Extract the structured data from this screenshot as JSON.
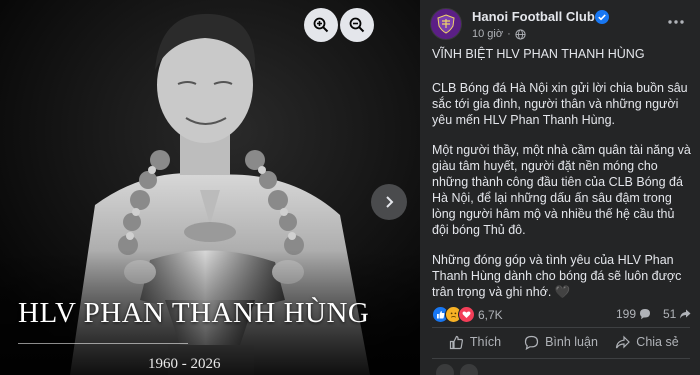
{
  "viewer": {
    "overlay_name": "HLV PHAN THANH HÙNG",
    "overlay_years": "1960 - 2026",
    "zoom_in_icon": "zoom-in-icon",
    "zoom_out_icon": "zoom-out-icon",
    "next_icon": "chevron-right-icon"
  },
  "post": {
    "page_name": "Hanoi Football Club",
    "time": "10 giờ",
    "heading": "VĨNH BIỆT HLV PHAN THANH HÙNG",
    "paragraphs": [
      "CLB Bóng đá Hà Nội xin gửi lời chia buồn sâu sắc tới gia đình, người thân và những người yêu mến HLV Phan Thanh Hùng.",
      "Một người thầy, một nhà cầm quân tài năng và giàu tâm huyết, người đặt nền móng cho những thành công đầu tiên của CLB Bóng đá Hà Nội, để lại những dấu ấn sâu đậm trong lòng người hâm mộ và nhiều thế hệ cầu thủ đội bóng Thủ đô.",
      "Những đóng góp và tình yêu của HLV Phan Thanh Hùng dành cho bóng đá sẽ luôn được trân trọng và ghi nhớ. 🖤"
    ],
    "reaction_count": "6,7K",
    "comment_count": "199",
    "share_count": "51",
    "actions": {
      "like": "Thích",
      "comment": "Bình luận",
      "share": "Chia sẻ"
    }
  },
  "colors": {
    "panel_bg": "#242526",
    "text": "#e4e6eb",
    "muted": "#b0b3b8",
    "verified": "#1877f2",
    "like_blue": "#1877f2",
    "sad_yellow": "#f7b125",
    "club_purple": "#5b1f86"
  }
}
